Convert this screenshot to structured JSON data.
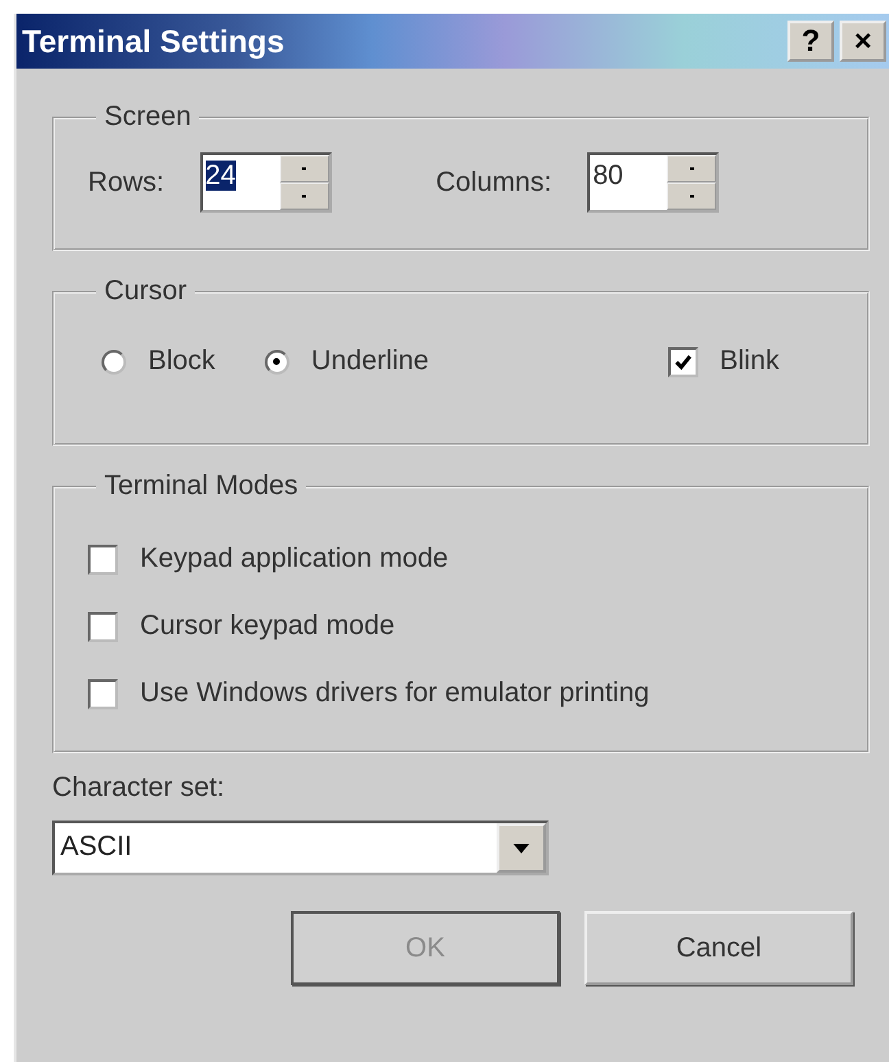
{
  "window": {
    "title": "Terminal Settings",
    "title_buttons": [
      "?",
      "×"
    ]
  },
  "screen": {
    "title": "Screen",
    "fields": [
      {
        "label": "Rows:",
        "value": "24",
        "selected": true
      },
      {
        "label": "Columns:",
        "value": "80",
        "selected": false
      }
    ]
  },
  "cursor": {
    "title": "Cursor",
    "options": [
      {
        "kind": "radio",
        "label": "Block",
        "checked": false
      },
      {
        "kind": "radio",
        "label": "Underline",
        "checked": true
      },
      {
        "kind": "checkbox",
        "label": "Blink",
        "checked": true
      }
    ]
  },
  "terminal_modes": {
    "title": "Terminal Modes",
    "options": [
      {
        "label": "Keypad application mode",
        "checked": false
      },
      {
        "label": "Cursor keypad mode",
        "checked": false
      },
      {
        "label": "Use Windows drivers for emulator printing",
        "checked": false
      }
    ]
  },
  "character_set": {
    "label": "Character set:",
    "value": "ASCII"
  },
  "buttons": [
    {
      "label": "OK",
      "disabled": true
    },
    {
      "label": "Cancel",
      "disabled": false
    }
  ]
}
